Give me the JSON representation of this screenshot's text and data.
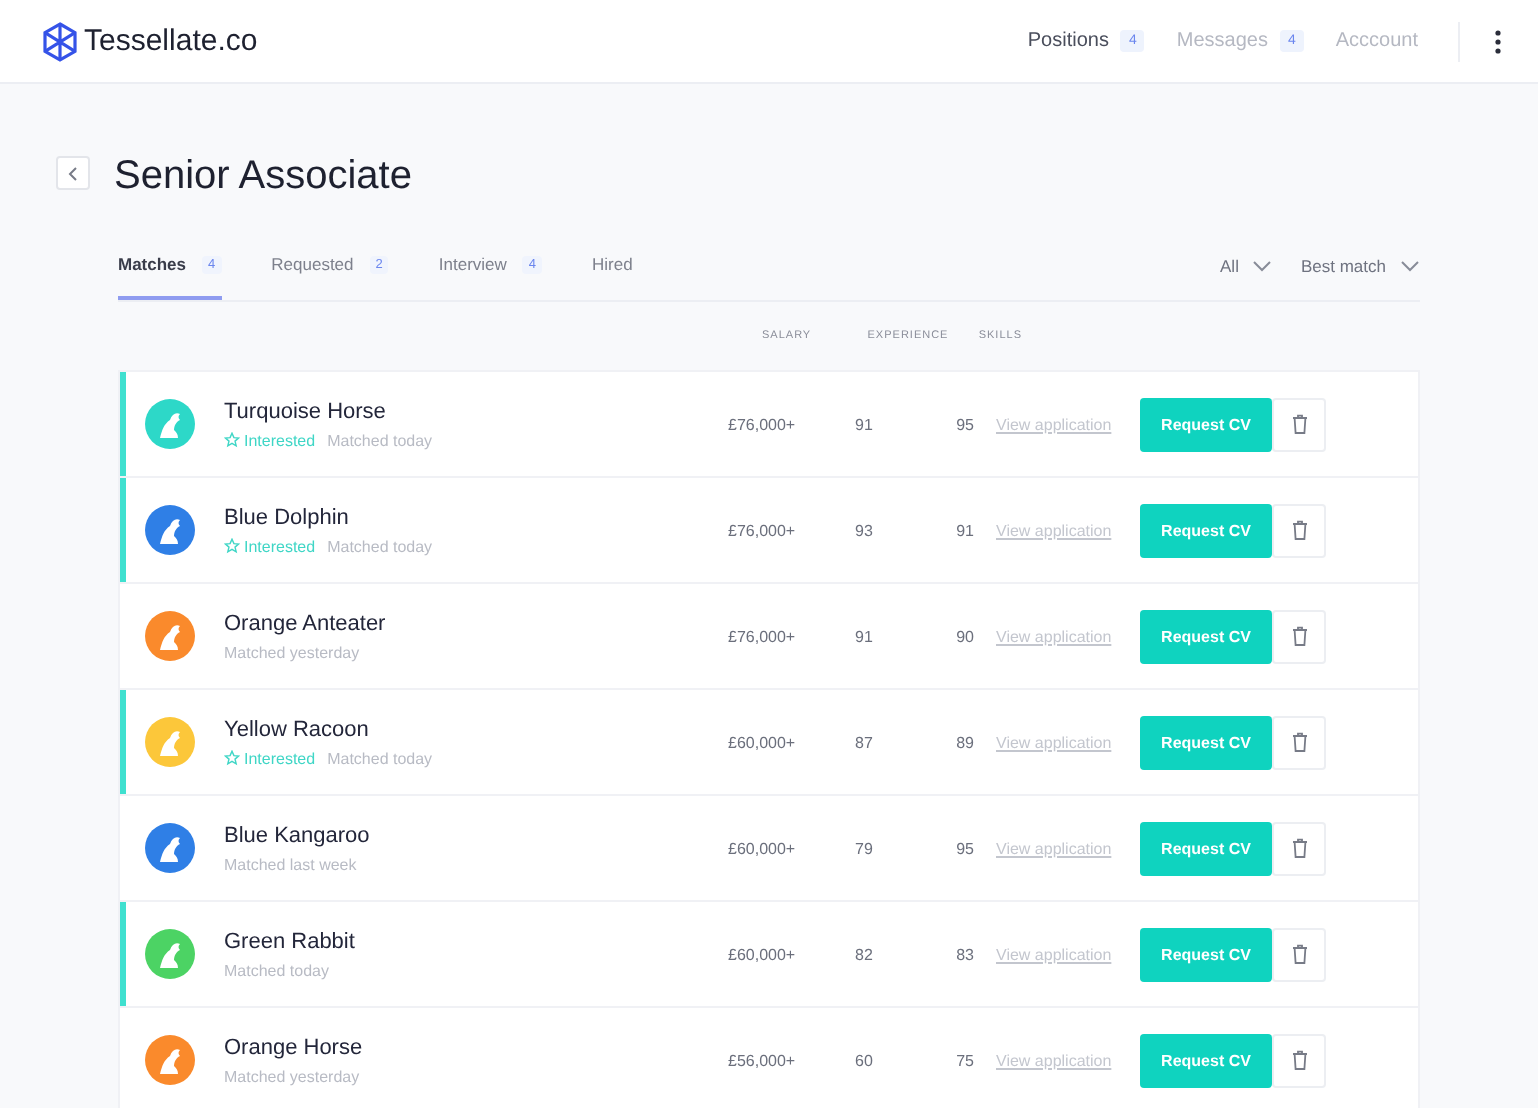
{
  "header": {
    "logo": "Tessellate.co",
    "nav": [
      {
        "label": "Positions",
        "badge": "4",
        "selected": true
      },
      {
        "label": "Messages",
        "badge": "4",
        "selected": false
      },
      {
        "label": "Acccount",
        "selected": false
      }
    ]
  },
  "page": {
    "title": "Senior Associate"
  },
  "tabs": [
    {
      "label": "Matches",
      "count": "4",
      "selected": true
    },
    {
      "label": "Requested",
      "count": "2",
      "selected": false
    },
    {
      "label": "Interview",
      "count": "4",
      "selected": false
    },
    {
      "label": "Hired",
      "selected": false
    }
  ],
  "filters": [
    "All",
    "Best match"
  ],
  "columns": [
    "SALARY",
    "EXPERIENCE",
    "SKILLS"
  ],
  "rows": [
    {
      "name": "Turquoise Horse",
      "highlighted": true,
      "color": "#2dd8c8",
      "interested": true,
      "interested_label": "Interested",
      "matched": "Matched today",
      "salary": "£76,000+",
      "experience": "91",
      "skills": "95",
      "link": "View application",
      "button": "Request CV"
    },
    {
      "name": "Blue Dolphin",
      "highlighted": true,
      "color": "#2f7fe6",
      "interested": true,
      "interested_label": "Interested",
      "matched": "Matched today",
      "salary": "£76,000+",
      "experience": "93",
      "skills": "91",
      "link": "View application",
      "button": "Request CV"
    },
    {
      "name": "Orange Anteater",
      "highlighted": false,
      "color": "#fa8a2c",
      "interested": false,
      "matched": "Matched yesterday",
      "salary": "£76,000+",
      "experience": "91",
      "skills": "90",
      "link": "View application",
      "button": "Request CV"
    },
    {
      "name": "Yellow Racoon",
      "highlighted": true,
      "color": "#fcc73a",
      "interested": true,
      "interested_label": "Interested",
      "matched": "Matched today",
      "salary": "£60,000+",
      "experience": "87",
      "skills": "89",
      "link": "View application",
      "button": "Request CV"
    },
    {
      "name": "Blue Kangaroo",
      "highlighted": false,
      "color": "#2f7fe6",
      "interested": false,
      "matched": "Matched last week",
      "salary": "£60,000+",
      "experience": "79",
      "skills": "95",
      "link": "View application",
      "button": "Request CV"
    },
    {
      "name": "Green Rabbit",
      "highlighted": true,
      "color": "#4cd364",
      "interested": false,
      "matched": "Matched today",
      "salary": "£60,000+",
      "experience": "82",
      "skills": "83",
      "link": "View application",
      "button": "Request CV"
    },
    {
      "name": "Orange Horse",
      "highlighted": false,
      "color": "#fa8a2c",
      "interested": false,
      "matched": "Matched yesterday",
      "salary": "£56,000+",
      "experience": "60",
      "skills": "75",
      "link": "View application",
      "button": "Request CV"
    }
  ]
}
